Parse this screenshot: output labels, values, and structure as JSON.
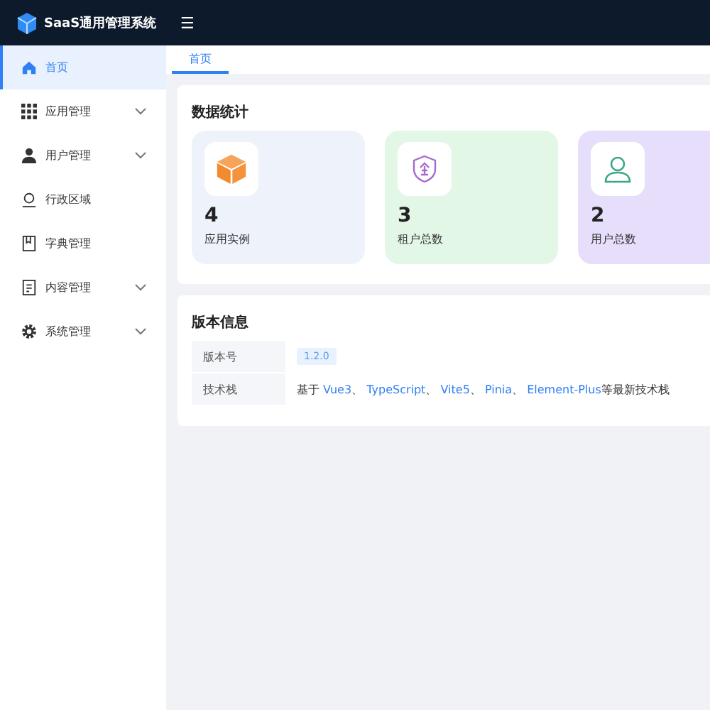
{
  "header": {
    "title": "SaaS通用管理系统",
    "menu_icon": "☰"
  },
  "sidebar": {
    "items": [
      {
        "kind": "home",
        "label": "首页",
        "selected": true,
        "expandable": false
      },
      {
        "kind": "grid",
        "label": "应用管理",
        "selected": false,
        "expandable": true
      },
      {
        "kind": "user",
        "label": "用户管理",
        "selected": false,
        "expandable": true
      },
      {
        "kind": "region",
        "label": "行政区域",
        "selected": false,
        "expandable": false
      },
      {
        "kind": "book",
        "label": "字典管理",
        "selected": false,
        "expandable": false
      },
      {
        "kind": "doc",
        "label": "内容管理",
        "selected": false,
        "expandable": true
      },
      {
        "kind": "gear",
        "label": "系统管理",
        "selected": false,
        "expandable": true
      }
    ]
  },
  "tabs": [
    {
      "label": "首页",
      "selected": true
    }
  ],
  "stats": {
    "title": "数据统计",
    "cards": [
      {
        "kind": "box",
        "value": "4",
        "label": "应用实例",
        "color": "#eef2fb"
      },
      {
        "kind": "shield",
        "value": "3",
        "label": "租户总数",
        "color": "#e3f7e6"
      },
      {
        "kind": "person",
        "value": "2",
        "label": "用户总数",
        "color": "#e6defa"
      }
    ]
  },
  "version": {
    "title": "版本信息",
    "rows": [
      {
        "kind": "tag",
        "label": "版本号",
        "value": "1.2.0"
      },
      {
        "kind": "links",
        "label": "技术栈",
        "prefix": "基于",
        "links": [
          "Vue3",
          "TypeScript",
          "Vite5",
          "Pinia",
          "Element-Plus"
        ],
        "separator": "、",
        "suffix": "等最新技术栈"
      }
    ]
  }
}
